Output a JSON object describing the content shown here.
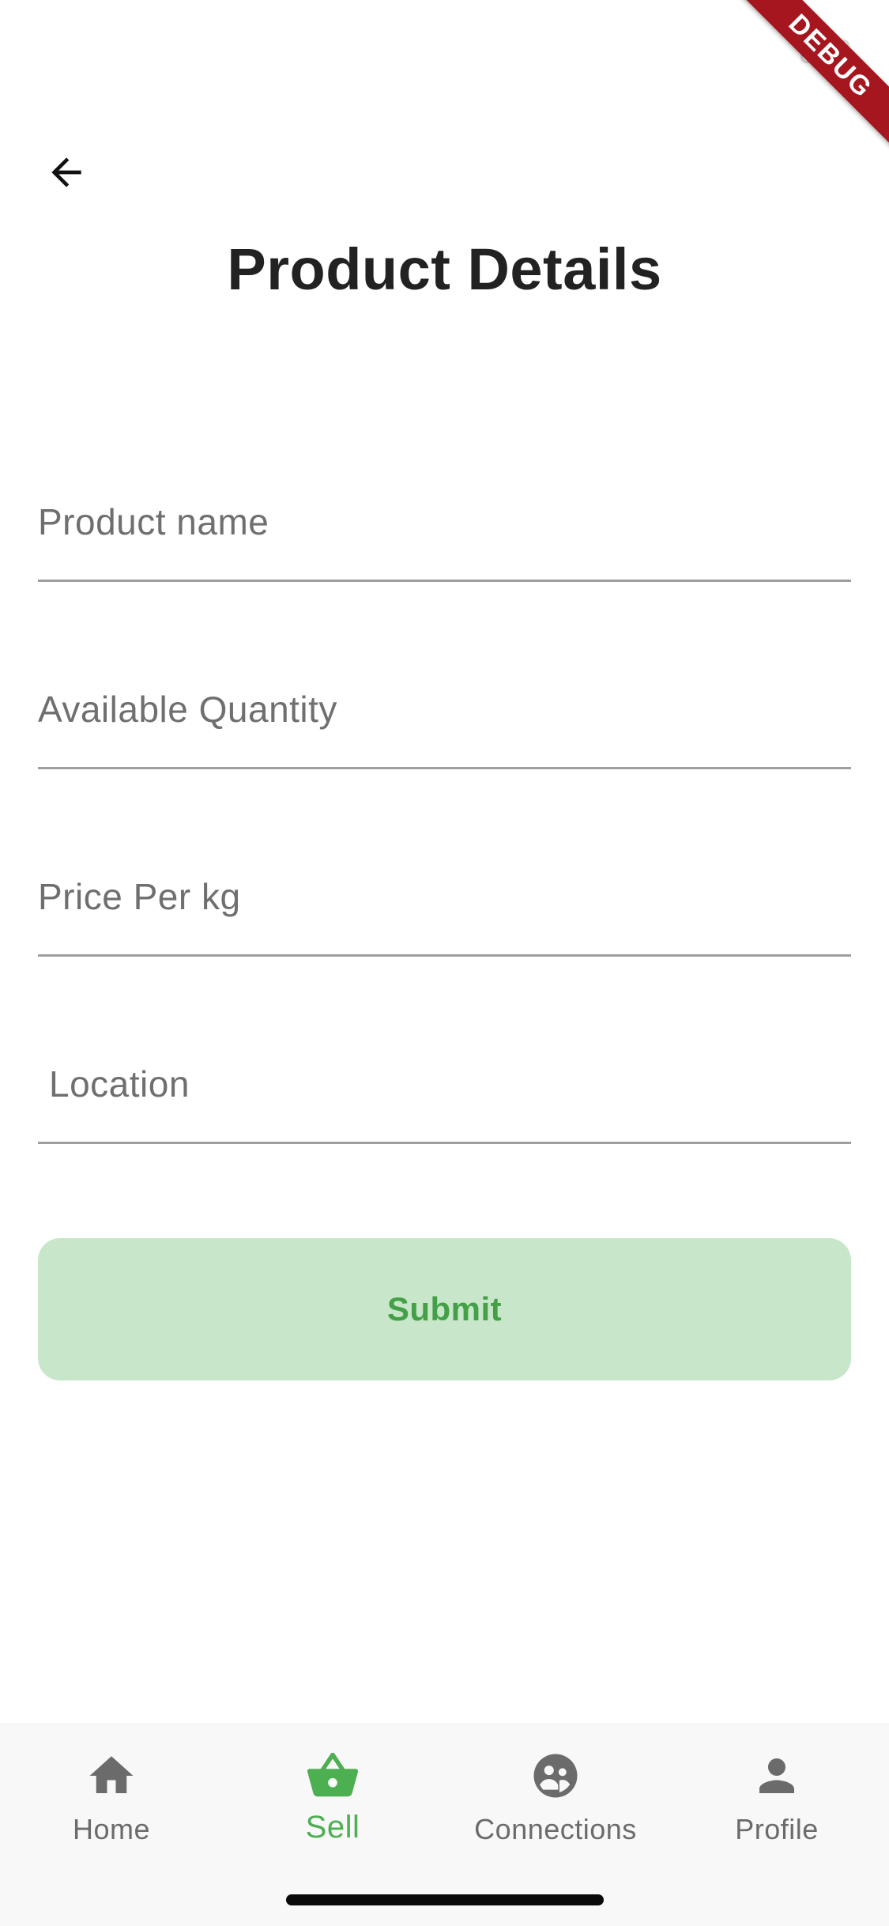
{
  "debug_banner": "DEBUG",
  "header": {
    "title": "Product Details",
    "back_icon": "arrow-back-icon"
  },
  "form": {
    "product_name": {
      "placeholder": "Product name",
      "value": ""
    },
    "available_quantity": {
      "placeholder": "Available Quantity",
      "value": ""
    },
    "price_per_kg": {
      "placeholder": "Price Per kg",
      "value": ""
    },
    "location": {
      "placeholder": "Location",
      "value": ""
    },
    "submit_label": "Submit"
  },
  "bottom_nav": {
    "items": [
      {
        "label": "Home",
        "icon": "home-icon",
        "active": false
      },
      {
        "label": "Sell",
        "icon": "basket-icon",
        "active": true
      },
      {
        "label": "Connections",
        "icon": "group-icon",
        "active": false
      },
      {
        "label": "Profile",
        "icon": "person-icon",
        "active": false
      }
    ]
  },
  "colors": {
    "accent": "#4caf50",
    "submit_bg": "#c8e6c9",
    "debug_banner": "#a6161f",
    "nav_inactive": "#6b6b6b",
    "title": "#222222"
  }
}
